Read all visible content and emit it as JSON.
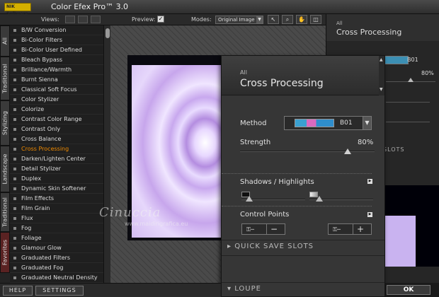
{
  "window": {
    "title": "Color Efex Pro™ 3.0",
    "logo_text": "NIK Software"
  },
  "toolbar": {
    "views_label": "Views:",
    "preview_label": "Preview:",
    "preview_checked": "✓",
    "modes_label": "Modes:",
    "mode_value": "Original Image"
  },
  "category_tabs": [
    "All",
    "Traditional",
    "Stylizing",
    "Landscape",
    "Traditional",
    "Favorites"
  ],
  "filters": [
    "B/W Conversion",
    "Bi-Color Filters",
    "Bi-Color User Defined",
    "Bleach Bypass",
    "Brilliance/Warmth",
    "Burnt Sienna",
    "Classical Soft Focus",
    "Color Stylizer",
    "Colorize",
    "Contrast Color Range",
    "Contrast Only",
    "Cross Balance",
    "Cross Processing",
    "Darken/Lighten Center",
    "Detail Stylizer",
    "Duplex",
    "Dynamic Skin Softener",
    "Film Effects",
    "Film Grain",
    "Flux",
    "Fog",
    "Foliage",
    "Glamour Glow",
    "Graduated Filters",
    "Graduated Fog",
    "Graduated Neutral Density"
  ],
  "selected_filter": "Cross Processing",
  "watermark": {
    "name": "Cinuccia",
    "url": "www.maidirigrafica.eu"
  },
  "background_panel": {
    "category": "All",
    "title": "Cross Processing",
    "method_value": "B01",
    "strength_value": "80%",
    "slots_label": "SLOTS",
    "ok_label": "OK"
  },
  "effect_panel": {
    "category": "All",
    "title": "Cross Processing",
    "method_label": "Method",
    "method_value": "B01",
    "strength_label": "Strength",
    "strength_value": "80%",
    "strength_level": 0.8,
    "shadows_highlights_label": "Shadows / Highlights",
    "shadow_level": 0.12,
    "highlight_level": 0.16,
    "control_points_label": "Control Points",
    "cp_minus": "−",
    "cp_plus": "+",
    "quick_save_label": "QUICK SAVE SLOTS",
    "loupe_label": "LOUPE"
  },
  "bottom_bar": {
    "help_label": "HELP",
    "settings_label": "SETTINGS"
  },
  "colors": {
    "selected_item": "#f08a00",
    "preview_lilac": "#c9b3f0"
  }
}
